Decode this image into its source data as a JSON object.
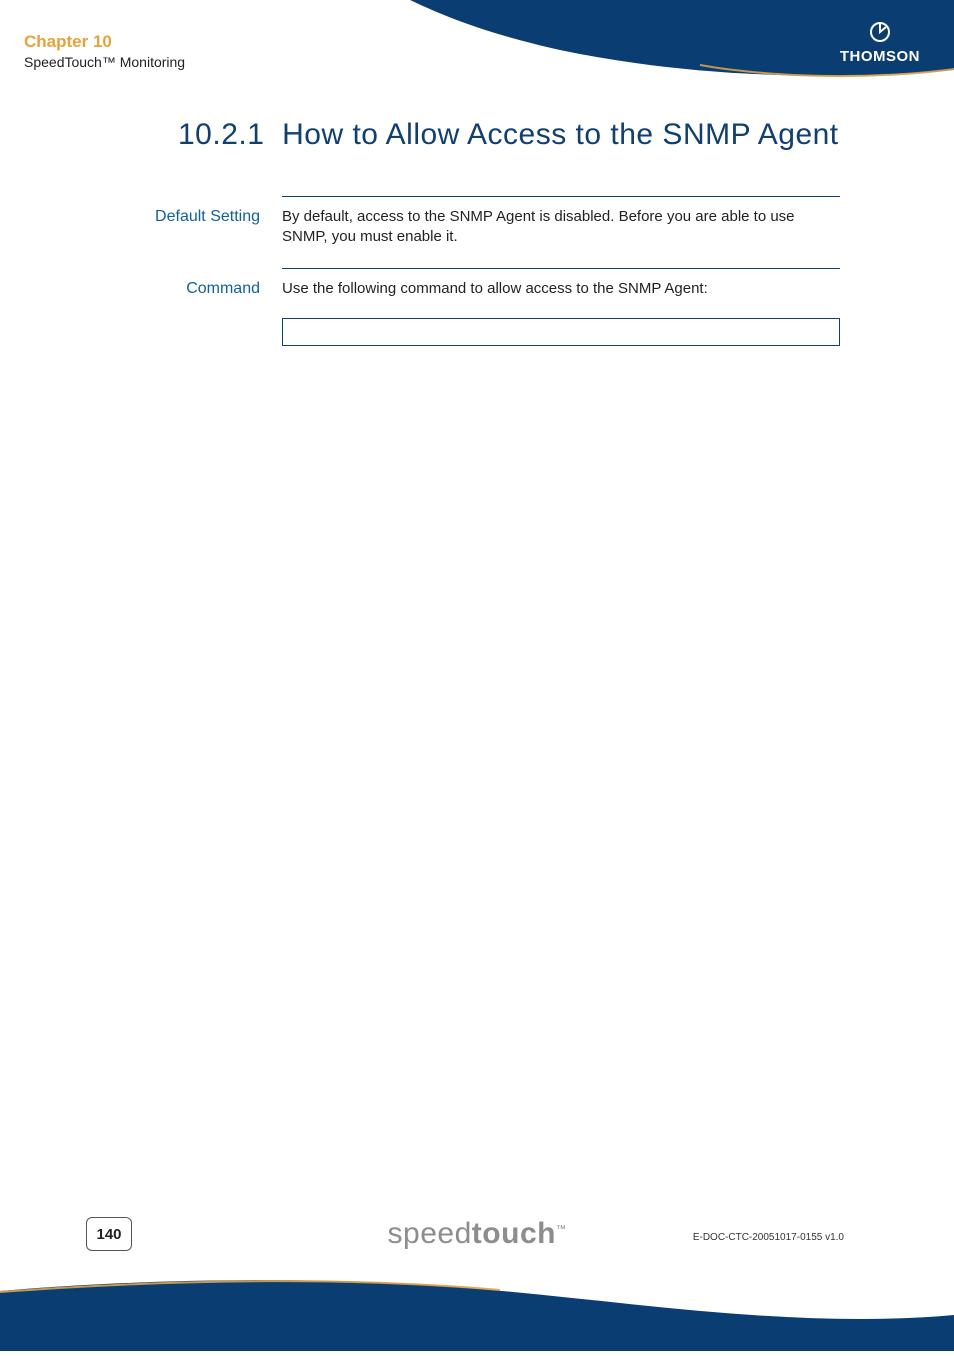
{
  "chapter": {
    "title": "Chapter 10",
    "subtitle": "SpeedTouch™ Monitoring"
  },
  "brand": {
    "name": "THOMSON"
  },
  "section": {
    "number": "10.2.1",
    "title": "How to Allow Access to the SNMP Agent"
  },
  "rows": [
    {
      "label": "Default Setting",
      "body": "By default, access to the SNMP Agent is disabled. Before you are able to use SNMP, you must enable it."
    },
    {
      "label": "Command",
      "body": "Use the following command to allow access to the SNMP Agent:"
    }
  ],
  "command_box": "",
  "footer": {
    "page_number": "140",
    "logo_light": "speed",
    "logo_bold": "touch",
    "logo_tm": "™",
    "doc_ref": "E-DOC-CTC-20051017-0155 v1.0"
  },
  "colors": {
    "navy": "#0a3e72",
    "accent": "#e8a23a",
    "link": "#0f5fa8"
  }
}
